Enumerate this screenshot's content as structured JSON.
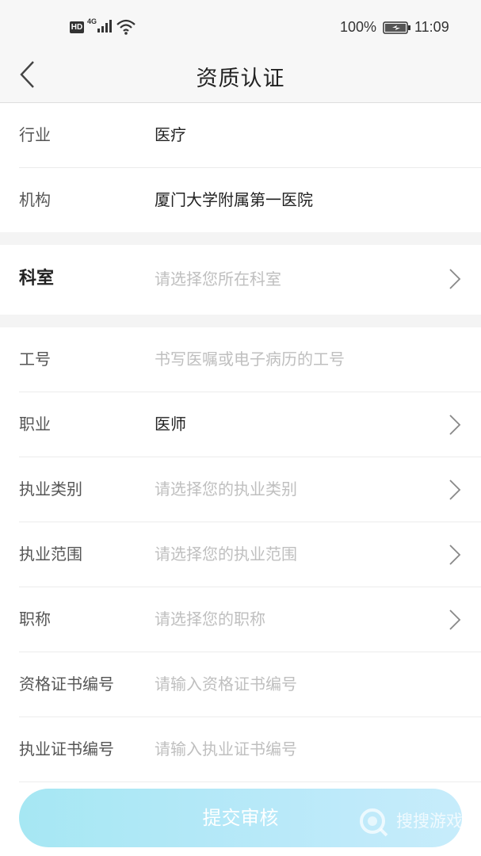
{
  "status_bar": {
    "network_badge": "HD",
    "network_type": "4G",
    "battery_percent": "100%",
    "time": "11:09",
    "icons": [
      "signal-icon",
      "wifi-icon",
      "battery-icon"
    ]
  },
  "navbar": {
    "title": "资质认证",
    "back_icon": "chevron-left-icon"
  },
  "fields": {
    "industry": {
      "label": "行业",
      "value": "医疗"
    },
    "institution": {
      "label": "机构",
      "value": "厦门大学附属第一医院"
    },
    "department": {
      "label": "科室",
      "placeholder": "请选择您所在科室"
    },
    "employee_id": {
      "label": "工号",
      "placeholder": "书写医嘱或电子病历的工号"
    },
    "occupation": {
      "label": "职业",
      "value": "医师"
    },
    "practice_category": {
      "label": "执业类别",
      "placeholder": "请选择您的执业类别"
    },
    "practice_scope": {
      "label": "执业范围",
      "placeholder": "请选择您的执业范围"
    },
    "title_rank": {
      "label": "职称",
      "placeholder": "请选择您的职称"
    },
    "qualification_no": {
      "label": "资格证书编号",
      "placeholder": "请输入资格证书编号"
    },
    "practice_license_no": {
      "label": "执业证书编号",
      "placeholder": "请输入执业证书编号"
    }
  },
  "submit_label": "提交审核",
  "watermark": "搜搜游戏",
  "colors": {
    "button_gradient_start": "#a6e7f3",
    "button_gradient_end": "#c7ecfb",
    "placeholder": "#bfbfbf",
    "divider": "#ececec",
    "section_gap": "#f4f4f4"
  }
}
